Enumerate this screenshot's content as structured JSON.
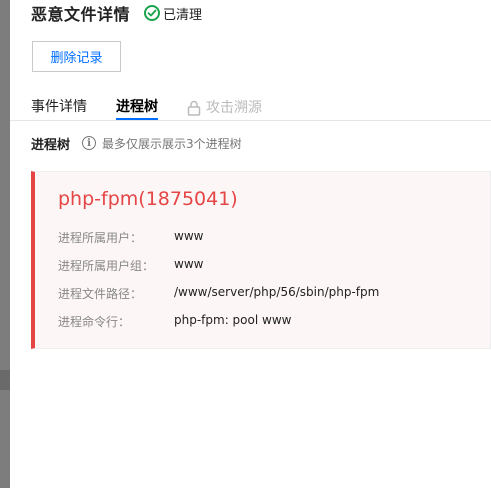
{
  "header": {
    "title": "恶意文件详情",
    "status_label": "已清理",
    "status_color": "#1aa34a",
    "status_icon": "check-circle-icon"
  },
  "actions": {
    "delete_label": "删除记录"
  },
  "tabs": [
    {
      "label": "事件详情",
      "active": false,
      "disabled": false
    },
    {
      "label": "进程树",
      "active": true,
      "disabled": false
    },
    {
      "label": "攻击溯源",
      "active": false,
      "disabled": true,
      "icon": "lock-icon"
    }
  ],
  "section": {
    "label": "进程树",
    "hint": "最多仅展示展示3个进程树",
    "hint_icon": "info-icon"
  },
  "process": {
    "title": "php-fpm(1875041)",
    "accent_color": "#e54545",
    "fields": [
      {
        "label": "进程所属用户：",
        "value": "www"
      },
      {
        "label": "进程所属用户组：",
        "value": "www"
      },
      {
        "label": "进程文件路径：",
        "value": "/www/server/php/56/sbin/php-fpm"
      },
      {
        "label": "进程命令行：",
        "value": "php-fpm: pool www"
      }
    ]
  },
  "colors": {
    "accent": "#006eff",
    "danger": "#e54545",
    "success": "#1aa34a"
  }
}
